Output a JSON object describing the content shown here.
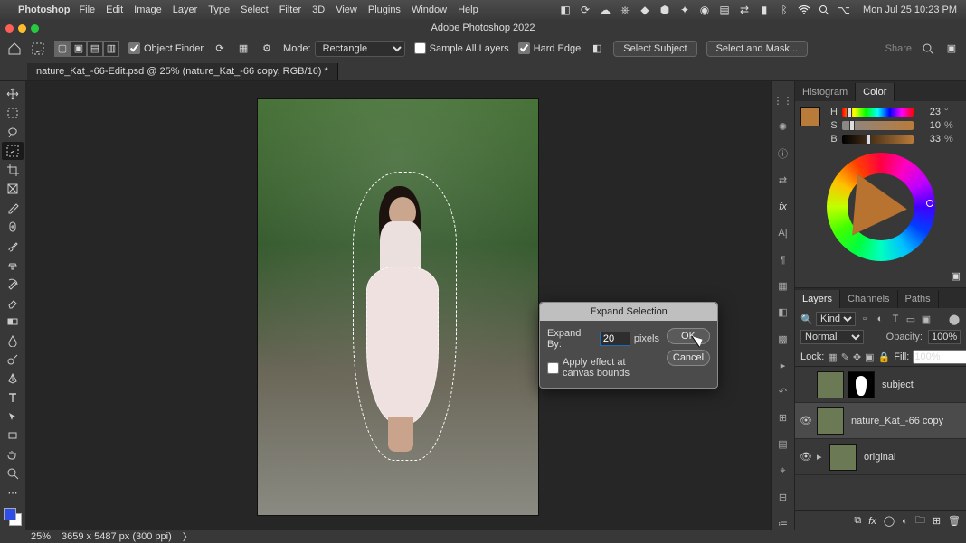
{
  "mac": {
    "app_name": "Photoshop",
    "menus": [
      "File",
      "Edit",
      "Image",
      "Layer",
      "Type",
      "Select",
      "Filter",
      "3D",
      "View",
      "Plugins",
      "Window",
      "Help"
    ],
    "datetime": "Mon Jul 25  10:23 PM"
  },
  "title": "Adobe Photoshop 2022",
  "options": {
    "object_finder": "Object Finder",
    "mode_label": "Mode:",
    "mode_value": "Rectangle",
    "sample_all_layers": "Sample All Layers",
    "hard_edge": "Hard Edge",
    "select_subject": "Select Subject",
    "select_and_mask": "Select and Mask...",
    "share": "Share"
  },
  "doc_tab": "nature_Kat_-66-Edit.psd @ 25% (nature_Kat_-66 copy, RGB/16) *",
  "hsb": {
    "h_label": "H",
    "s_label": "S",
    "b_label": "B",
    "h": 23,
    "s": 10,
    "b": 33,
    "h_unit": "°",
    "s_unit": "%",
    "b_unit": "%"
  },
  "panels": {
    "histogram": "Histogram",
    "color": "Color",
    "layers": "Layers",
    "channels": "Channels",
    "paths": "Paths"
  },
  "layers_opts": {
    "kind_label": "Kind",
    "blend": "Normal",
    "opacity_label": "Opacity:",
    "opacity": "100%",
    "lock_label": "Lock:",
    "fill_label": "Fill:",
    "fill": "100%"
  },
  "layers": [
    {
      "name": "subject",
      "hasMask": true,
      "visible": false
    },
    {
      "name": "nature_Kat_-66 copy",
      "hasMask": false,
      "visible": true,
      "selected": true
    },
    {
      "name": "original",
      "hasMask": false,
      "visible": true
    }
  ],
  "dialog": {
    "title": "Expand Selection",
    "expand_by_label": "Expand By:",
    "expand_by_value": "20",
    "pixels": "pixels",
    "apply_canvas": "Apply effect at canvas bounds",
    "ok": "OK",
    "cancel": "Cancel"
  },
  "status": {
    "zoom": "25%",
    "doc_info": "3659 x 5487 px (300 ppi)"
  }
}
